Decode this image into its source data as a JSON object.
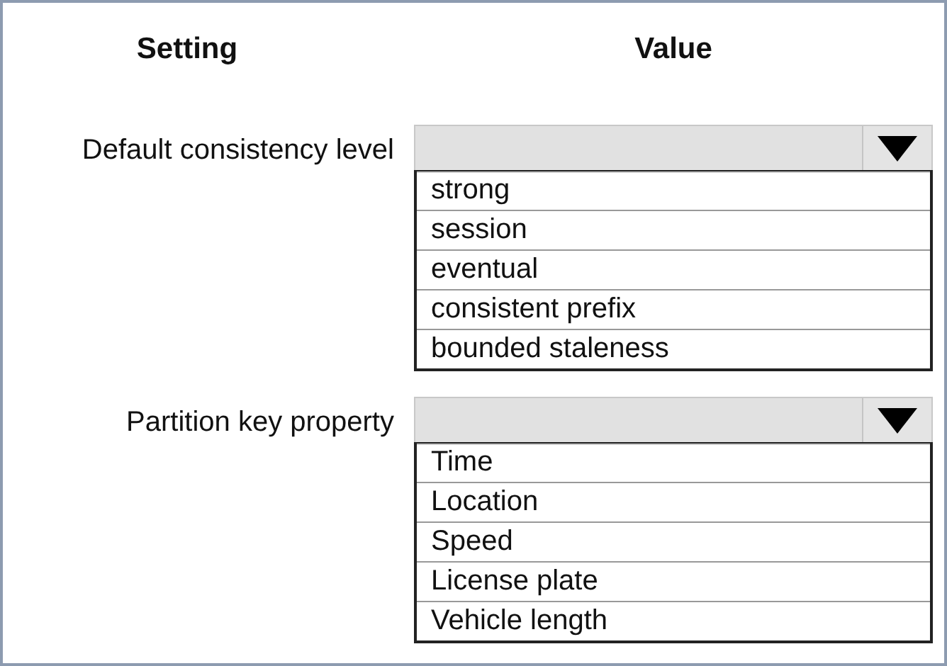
{
  "headers": {
    "setting": "Setting",
    "value": "Value"
  },
  "settings": [
    {
      "label": "Default consistency level",
      "options": [
        "strong",
        "session",
        "eventual",
        "consistent prefix",
        "bounded staleness"
      ]
    },
    {
      "label": "Partition key property",
      "options": [
        "Time",
        "Location",
        "Speed",
        "License plate",
        "Vehicle length"
      ]
    }
  ]
}
